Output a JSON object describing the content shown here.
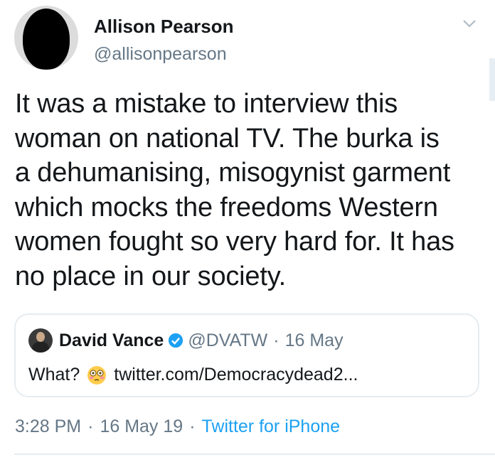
{
  "author": {
    "display_name": "Allison Pearson",
    "handle": "@allisonpearson"
  },
  "tweet": {
    "text": "It was a mistake to interview this\nwoman on national TV. The burka is\na dehumanising, misogynist garment\nwhich mocks the freedoms Western\nwomen fought so very hard for. It has\nno place in our society."
  },
  "quoted_tweet": {
    "display_name": "David Vance",
    "handle": "@DVATW",
    "separator": "·",
    "date": "16 May",
    "text": "What?",
    "emoji": "flushed-face-emoji",
    "link": "twitter.com/Democracydead2..."
  },
  "meta": {
    "time": "3:28 PM",
    "separator": "·",
    "date": "16 May 19",
    "source": "Twitter for iPhone"
  },
  "colors": {
    "text": "#14171a",
    "secondary": "#657786",
    "link": "#1da1f2",
    "border": "#e6ecf0",
    "verified": "#1da1f2"
  },
  "icons": {
    "caret": "chevron-down-icon",
    "verified": "verified-badge-icon"
  }
}
